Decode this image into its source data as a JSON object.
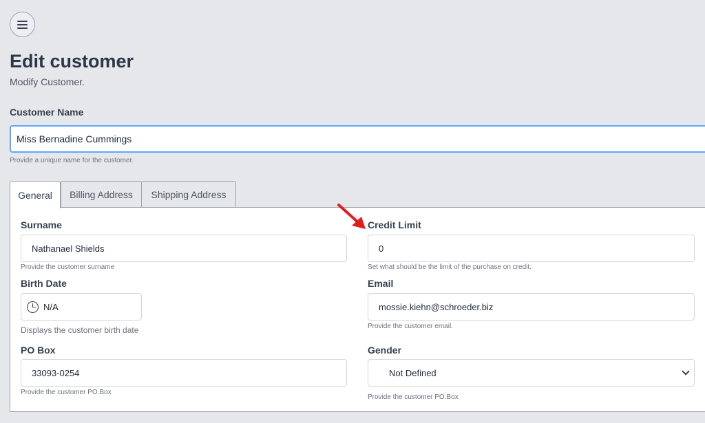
{
  "header": {
    "title": "Edit customer",
    "subtitle": "Modify Customer."
  },
  "customer_name": {
    "label": "Customer Name",
    "value": "Miss Bernadine Cummings",
    "help": "Provide a unique name for the customer."
  },
  "tabs": [
    {
      "label": "General",
      "active": true
    },
    {
      "label": "Billing Address",
      "active": false
    },
    {
      "label": "Shipping Address",
      "active": false
    }
  ],
  "general": {
    "surname": {
      "label": "Surname",
      "value": "Nathanael Shields",
      "help": "Provide the customer surname"
    },
    "credit_limit": {
      "label": "Credit Limit",
      "value": "0",
      "help": "Set what should be the limit of the purchase on credit."
    },
    "birth_date": {
      "label": "Birth Date",
      "value": "N/A",
      "help": "Displays the customer birth date",
      "icon": "clock-icon"
    },
    "email": {
      "label": "Email",
      "value": "mossie.kiehn@schroeder.biz",
      "help": "Provide the customer email."
    },
    "po_box": {
      "label": "PO Box",
      "value": "33093-0254",
      "help": "Provide the customer PO.Box"
    },
    "gender": {
      "label": "Gender",
      "value": "Not Defined",
      "help": "Provide the customer PO.Box",
      "icon": "chevron-down-icon"
    }
  },
  "colors": {
    "background": "#e5e7eb",
    "focus_border": "#60a5fa",
    "annotation_arrow": "#e11d1d"
  }
}
